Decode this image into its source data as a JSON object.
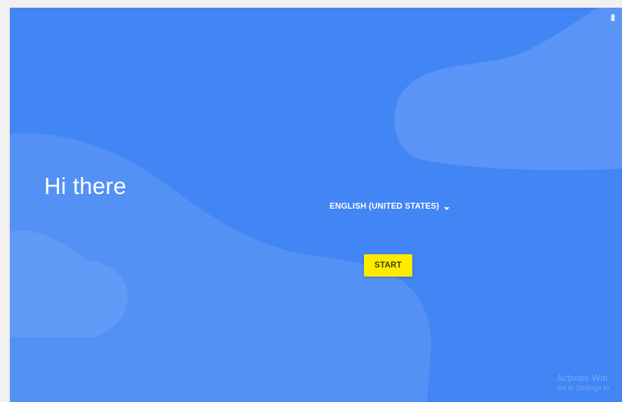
{
  "welcome": {
    "greeting": "Hi there",
    "language": {
      "selected": "ENGLISH (UNITED STATES)",
      "icon": "dropdown-caret-icon"
    },
    "start_label": "START"
  },
  "status_bar": {
    "icon": "battery-icon"
  },
  "watermark": {
    "title": "Activate Win",
    "subtitle": "Go to Settings to"
  },
  "colors": {
    "background": "#4285f4",
    "start_button": "#ffeb00",
    "text": "#ffffff"
  }
}
